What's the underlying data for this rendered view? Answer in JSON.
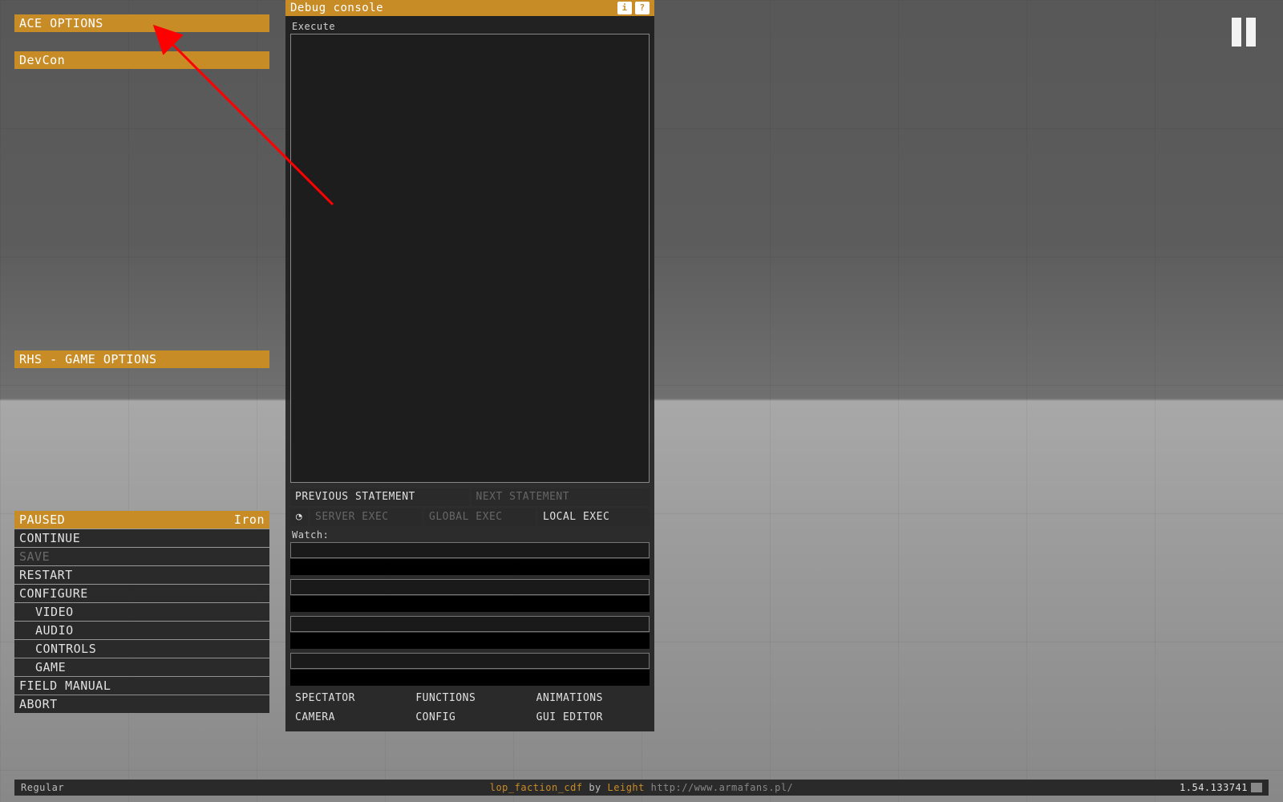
{
  "colors": {
    "accent": "#c88c27"
  },
  "left": {
    "ace_options": "ACE OPTIONS",
    "devcon": "DevCon",
    "rhs": "RHS - GAME OPTIONS"
  },
  "pause": {
    "paused": "PAUSED",
    "difficulty": "Iron",
    "continue": "CONTINUE",
    "save": "SAVE",
    "restart": "RESTART",
    "configure": "CONFIGURE",
    "video": "VIDEO",
    "audio": "AUDIO",
    "controls": "CONTROLS",
    "game": "GAME",
    "field_manual": "FIELD MANUAL",
    "abort": "ABORT"
  },
  "debug": {
    "title": "Debug console",
    "execute_label": "Execute",
    "prev": "PREVIOUS STATEMENT",
    "next": "NEXT STATEMENT",
    "server_exec": "SERVER EXEC",
    "global_exec": "GLOBAL EXEC",
    "local_exec": "LOCAL EXEC",
    "watch_label": "Watch:",
    "tools": {
      "spectator": "SPECTATOR",
      "functions": "FUNCTIONS",
      "animations": "ANIMATIONS",
      "camera": "CAMERA",
      "config": "CONFIG",
      "gui": "GUI EDITOR"
    }
  },
  "bottom": {
    "left": "Regular",
    "mission": "lop_faction_cdf",
    "by": "by",
    "author": "Leight",
    "link": "http://www.armafans.pl/",
    "version": "1.54.133741"
  }
}
